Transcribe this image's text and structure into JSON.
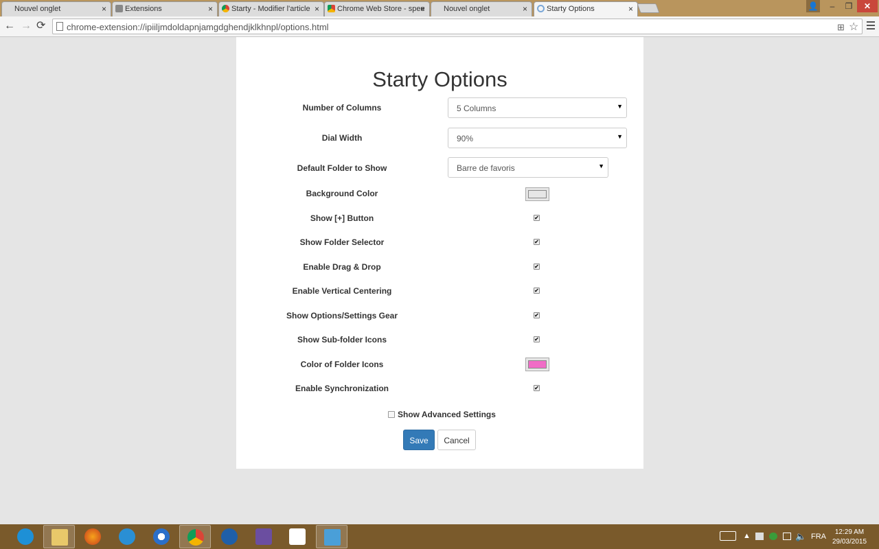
{
  "browser": {
    "tabs": [
      {
        "title": "Nouvel onglet",
        "close": "×"
      },
      {
        "title": "Extensions",
        "close": "×"
      },
      {
        "title": "Starty - Modifier l'article",
        "close": "×"
      },
      {
        "title": "Chrome Web Store - spee",
        "close": "×"
      },
      {
        "title": "Nouvel onglet",
        "close": "×"
      },
      {
        "title": "Starty Options",
        "close": "×"
      }
    ],
    "url": "chrome-extension://ipiiljmdoldapnjamgdghendjklkhnpl/options.html",
    "icons": {
      "back": "←",
      "forward": "→",
      "reload": "⟳",
      "star": "☆",
      "translate": "⊞"
    },
    "window_controls": {
      "user": "👤",
      "minimize": "–",
      "maximize": "❐",
      "close": "✕"
    }
  },
  "options": {
    "title": "Starty Options",
    "columns_label": "Number of Columns",
    "columns_value": "5 Columns",
    "dial_width_label": "Dial Width",
    "dial_width_value": "90%",
    "default_folder_label": "Default Folder to Show",
    "default_folder_value": "Barre de favoris",
    "bg_color_label": "Background Color",
    "bg_color": "#e6e6e6",
    "show_plus_label": "Show [+] Button",
    "show_folder_selector_label": "Show Folder Selector",
    "drag_drop_label": "Enable Drag & Drop",
    "vertical_centering_label": "Enable Vertical Centering",
    "settings_gear_label": "Show Options/Settings Gear",
    "subfolder_icons_label": "Show Sub-folder Icons",
    "folder_icon_color_label": "Color of Folder Icons",
    "folder_icon_color": "#f06cc6",
    "sync_label": "Enable Synchronization",
    "advanced_label": "Show Advanced Settings",
    "save_label": "Save",
    "cancel_label": "Cancel",
    "check": "✔",
    "caret": "▼"
  },
  "taskbar": {
    "language": "FRA",
    "time": "12:29 AM",
    "date": "29/03/2015",
    "apps": [
      "internet-explorer",
      "file-explorer",
      "firefox",
      "notepad",
      "media-player",
      "chrome",
      "thunderbird",
      "php-designer",
      "start-apps",
      "image-viewer"
    ]
  }
}
